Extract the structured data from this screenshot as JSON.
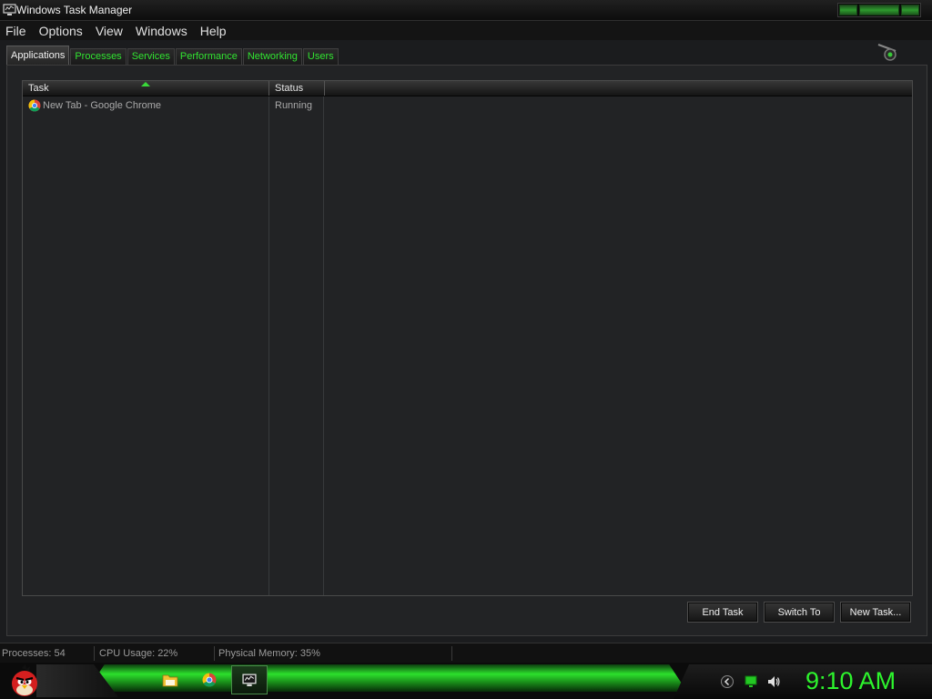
{
  "window": {
    "title": "Windows Task Manager"
  },
  "menu": [
    "File",
    "Options",
    "View",
    "Windows",
    "Help"
  ],
  "tabs": [
    {
      "label": "Applications",
      "active": true
    },
    {
      "label": "Processes",
      "active": false
    },
    {
      "label": "Services",
      "active": false
    },
    {
      "label": "Performance",
      "active": false
    },
    {
      "label": "Networking",
      "active": false
    },
    {
      "label": "Users",
      "active": false
    }
  ],
  "columns": {
    "task": "Task",
    "status": "Status"
  },
  "rows": [
    {
      "task": "New Tab - Google Chrome",
      "status": "Running",
      "icon": "chrome-icon"
    }
  ],
  "buttons": {
    "end_task": "End Task",
    "switch_to": "Switch To",
    "new_task": "New Task..."
  },
  "statusbar": {
    "processes": "Processes: 54",
    "cpu": "CPU Usage: 22%",
    "memory": "Physical Memory: 35%"
  },
  "taskbar": {
    "items": [
      "folder-icon",
      "chrome-icon",
      "task-manager-icon"
    ],
    "active_item": "task-manager-icon",
    "clock": "9:10 AM"
  },
  "colors": {
    "accent": "#32e432",
    "background": "#222325",
    "text": "#d8d8d8"
  }
}
